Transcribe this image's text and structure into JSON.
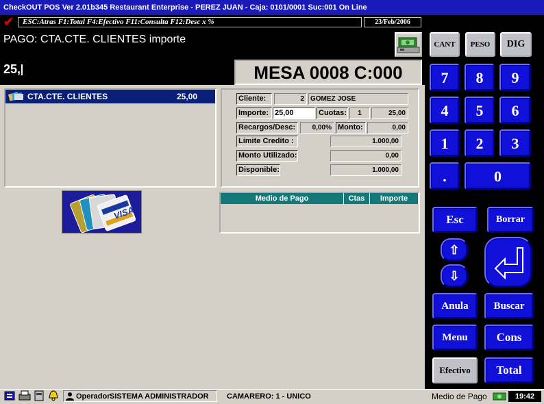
{
  "window": {
    "title": "CheckOUT POS Ver 2.01b345 Restaurant Enterprise - PEREZ JUAN - Caja: 0101/0001 Suc:001  On Line"
  },
  "toolbar": {
    "hints": "ESC:Atras F1:Total F4:Efectivo F11:Consulta F12:Desc x %",
    "date": "23/Feb/2006"
  },
  "prompt": {
    "label": "PAGO: CTA.CTE. CLIENTES importe",
    "input_value": "25,"
  },
  "mesa": {
    "label": "MESA 0008 C:000"
  },
  "payments_list": {
    "items": [
      {
        "name": "CTA.CTE. CLIENTES",
        "amount": "25,00"
      }
    ]
  },
  "client_info": {
    "cliente_label": "Cliente:",
    "cliente_num": "2",
    "cliente_name": "GOMEZ JOSE",
    "importe_label": "Importe:",
    "importe_value": "25,00",
    "cuotas_label": "Cuotas:",
    "cuotas_value": "1",
    "cuotas_amount": "25,00",
    "recargos_label": "Recargos/Desc:",
    "recargos_value": "0,00%",
    "monto_label": "Monto:",
    "monto_value": "0,00",
    "limite_label": "Limite Credito :",
    "limite_value": "1.000,00",
    "utilizado_label": "Monto Utilizado:",
    "utilizado_value": "0,00",
    "disponible_label": "Disponible:",
    "disponible_value": "1.000,00"
  },
  "card_logo": {
    "text": "VISA"
  },
  "pago_table": {
    "headers": [
      "Medio de Pago",
      "Ctas",
      "Importe"
    ]
  },
  "keypad": {
    "top": [
      "CANT",
      "PESO",
      "DIG"
    ],
    "digits": [
      "7",
      "8",
      "9",
      "4",
      "5",
      "6",
      "1",
      "2",
      "3"
    ],
    "dot": ".",
    "zero": "0",
    "esc": "Esc",
    "borrar": "Borrar",
    "up": "⇧",
    "down": "⇩",
    "anula": "Anula",
    "buscar": "Buscar",
    "menu": "Menu",
    "cons": "Cons",
    "efectivo": "Efectivo",
    "total": "Total"
  },
  "status": {
    "operador_label": "Operador",
    "operador_value": "SISTEMA ADMINISTRADOR",
    "camarero": "CAMARERO: 1 -  UNICO",
    "medio": "Medio de Pago",
    "time": "19:42"
  },
  "colors": {
    "title_bg": "#1a1ab8",
    "key_blue": "#1010d8",
    "selection": "#0a1f7a",
    "header_teal": "#147878"
  }
}
